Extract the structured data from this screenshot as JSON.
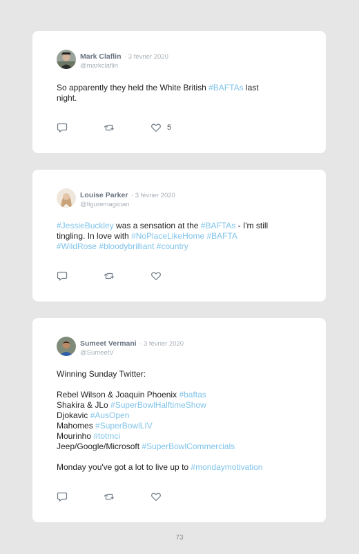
{
  "tweets": [
    {
      "name": "Mark Claflin",
      "date": "· 3 février 2020",
      "handle": "@markclaflin",
      "lines": [
        [
          {
            "t": "So apparently they held the White British ",
            "tag": false
          },
          {
            "t": "#BAFTAs",
            "tag": true
          },
          {
            "t": " last",
            "tag": false
          }
        ],
        [
          {
            "t": "night.",
            "tag": false
          }
        ]
      ],
      "likes": "5"
    },
    {
      "name": "Louise Parker",
      "date": "· 3 février 2020",
      "handle": "@figuremagician",
      "lines": [
        [
          {
            "t": "#JessieBuckley",
            "tag": true
          },
          {
            "t": " was a sensation at the ",
            "tag": false
          },
          {
            "t": "#BAFTAs",
            "tag": true
          },
          {
            "t": " - I'm still",
            "tag": false
          }
        ],
        [
          {
            "t": "tingling. In love with ",
            "tag": false
          },
          {
            "t": "#NoPlaceLikeHome",
            "tag": true
          },
          {
            "t": " ",
            "tag": false
          },
          {
            "t": "#BAFTA",
            "tag": true
          }
        ],
        [
          {
            "t": "#WildRose",
            "tag": true
          },
          {
            "t": " ",
            "tag": false
          },
          {
            "t": "#bloodybrilliant",
            "tag": true
          },
          {
            "t": " ",
            "tag": false
          },
          {
            "t": "#country",
            "tag": true
          }
        ]
      ],
      "likes": ""
    },
    {
      "name": "Sumeet Vermani",
      "date": "· 3 février 2020",
      "handle": "@SumeetV",
      "lines": [
        [
          {
            "t": "Winning Sunday Twitter:",
            "tag": false
          }
        ],
        [],
        [
          {
            "t": "Rebel Wilson & Joaquin Phoenix ",
            "tag": false
          },
          {
            "t": "#baftas",
            "tag": true
          }
        ],
        [
          {
            "t": "Shakira & JLo ",
            "tag": false
          },
          {
            "t": "#SuperBowlHalftimeShow",
            "tag": true
          }
        ],
        [
          {
            "t": "Djokavic ",
            "tag": false
          },
          {
            "t": "#AusOpen",
            "tag": true
          }
        ],
        [
          {
            "t": "Mahomes ",
            "tag": false
          },
          {
            "t": "#SuperBowlLIV",
            "tag": true
          }
        ],
        [
          {
            "t": "Mourinho ",
            "tag": false
          },
          {
            "t": "#totmci",
            "tag": true
          }
        ],
        [
          {
            "t": "Jeep/Google/Microsoft ",
            "tag": false
          },
          {
            "t": "#SuperBowlCommercials",
            "tag": true
          }
        ],
        [],
        [
          {
            "t": "Monday you've got a lot to live up to ",
            "tag": false
          },
          {
            "t": "#mondaymotivation",
            "tag": true
          }
        ]
      ],
      "likes": ""
    }
  ],
  "page_number": "73",
  "colors": {
    "hashtag": "#7fc3ea",
    "name": "#6a7480",
    "meta": "#a9b0b7",
    "icon": "#6f7a86"
  }
}
